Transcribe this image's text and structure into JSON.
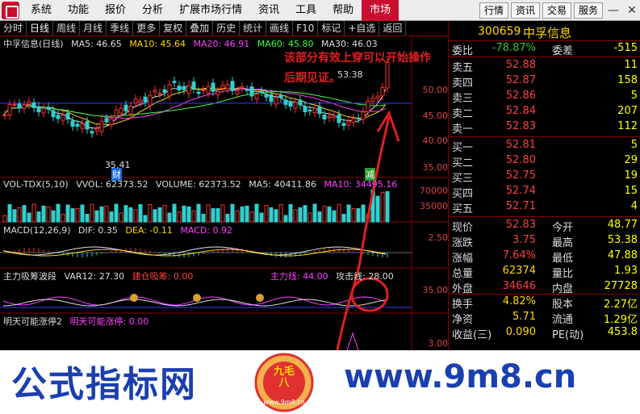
{
  "menubar": {
    "items": [
      "系统",
      "功能",
      "报价",
      "分析",
      "扩展市场行情",
      "资讯",
      "工具",
      "帮助"
    ],
    "active": "市场",
    "right": [
      "行情",
      "资讯",
      "交易",
      "服务"
    ]
  },
  "toolbar": {
    "items": [
      "分时",
      "日线",
      "周线",
      "月线",
      "季线",
      "更多",
      "复权",
      "叠加",
      "历史",
      "统计",
      "画线",
      "F10",
      "标记",
      "+自选",
      "返回"
    ],
    "active": "日线"
  },
  "main": {
    "title": "中孚信息(日线)",
    "ma5": "MA5: 46.65",
    "ma10": "MA10: 45.64",
    "ma20": "MA20: 46.91",
    "ma60": "MA60: 45.80",
    "ma30": "MA30: 46.03",
    "yaxis": [
      "50.00",
      "45.00",
      "40.00",
      "35.00"
    ],
    "high": "53.38",
    "low": "35.41",
    "low_badge": "财",
    "cut_badge": "减"
  },
  "volume": {
    "title": "VOL-TDX(5,10)",
    "vvol": "VVOL: 62373.52",
    "volume": "VOLUME: 62373.52",
    "ma5": "MA5: 40411.86",
    "ma10": "MA10: 34495.16",
    "yaxis": [
      "70000",
      "35000"
    ]
  },
  "macd": {
    "title": "MACD(12,26,9)",
    "dif": "DIF: 0.35",
    "dea": "DEA: -0.11",
    "macd": "MACD: 0.92",
    "yaxis": [
      "2.50"
    ]
  },
  "zljc": {
    "title": "主力吸筹波段",
    "var12": "VAR12: 27.30",
    "jc": "建仓吸筹: 0.00",
    "zlx": "主力线: 44.00",
    "gjx": "攻击线: 28.00",
    "yaxis": [
      "35.00"
    ]
  },
  "mtkn": {
    "title": "明天可能涨停2",
    "val": "明天可能涨停: 0.00",
    "yaxis": [
      "3.00"
    ]
  },
  "sidebar": {
    "code": "300659",
    "name": "中孚信息",
    "weibi_label": "委比",
    "weibi": "-78.87%",
    "weicha_label": "委差",
    "weicha": "-515",
    "asks": [
      {
        "l": "卖五",
        "p": "52.88",
        "v": "11"
      },
      {
        "l": "卖四",
        "p": "52.87",
        "v": "158"
      },
      {
        "l": "卖三",
        "p": "52.86",
        "v": "5"
      },
      {
        "l": "卖二",
        "p": "52.84",
        "v": "207"
      },
      {
        "l": "卖一",
        "p": "52.83",
        "v": "112"
      }
    ],
    "bids": [
      {
        "l": "买一",
        "p": "52.81",
        "v": "5"
      },
      {
        "l": "买二",
        "p": "52.80",
        "v": "29"
      },
      {
        "l": "买三",
        "p": "52.75",
        "v": "19"
      },
      {
        "l": "买四",
        "p": "52.74",
        "v": "15"
      },
      {
        "l": "买五",
        "p": "52.71",
        "v": "4"
      }
    ],
    "stats": [
      {
        "a": "现价",
        "b": "52.83",
        "bc": "red",
        "c": "今开",
        "d": "48.77",
        "dc": "grn"
      },
      {
        "a": "涨跌",
        "b": "3.75",
        "bc": "red",
        "c": "最高",
        "d": "53.38",
        "dc": "red"
      },
      {
        "a": "涨幅",
        "b": "7.64%",
        "bc": "red",
        "c": "最低",
        "d": "47.88",
        "dc": "grn"
      },
      {
        "a": "总量",
        "b": "62374",
        "bc": "yel",
        "c": "量比",
        "d": "1.93",
        "dc": "red"
      },
      {
        "a": "外盘",
        "b": "34646",
        "bc": "red",
        "c": "内盘",
        "d": "27728",
        "dc": "grn"
      },
      {
        "a": "换手",
        "b": "4.82%",
        "bc": "yel",
        "c": "股本",
        "d": "2.27亿",
        "dc": "yel"
      },
      {
        "a": "净资",
        "b": "5.71",
        "bc": "yel",
        "c": "流通",
        "d": "1.29亿",
        "dc": "yel"
      },
      {
        "a": "收益(三)",
        "b": "0.090",
        "bc": "yel",
        "c": "PE(动)",
        "d": "453.8",
        "dc": "yel"
      }
    ]
  },
  "annotation": {
    "line1": "该部分有效上穿可以开始操作",
    "line2": "后期见证。"
  },
  "banner": {
    "left": "公式指标网",
    "right": "www.9m8.cn",
    "seal": "九毛八",
    "seal_url": "www.9m8.cn"
  }
}
